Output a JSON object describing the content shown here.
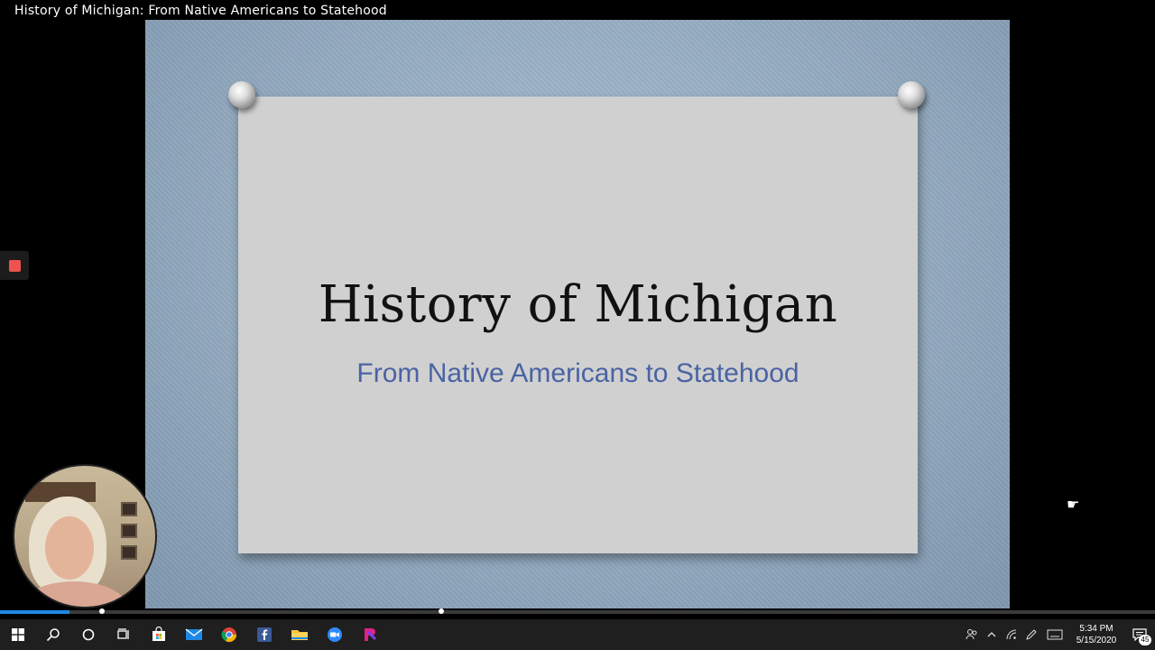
{
  "video": {
    "title": "History of Michigan: From Native Americans to Statehood",
    "progress_fraction": 0.06
  },
  "slide": {
    "title": "History of Michigan",
    "subtitle": "From Native Americans to Statehood",
    "subtitle_color": "#4a63a4",
    "card_color": "#d0d0d0"
  },
  "recorder": {
    "stop_icon": "stop-square-icon",
    "stop_color": "#ef5350"
  },
  "taskbar": {
    "apps": [
      {
        "name": "windows-start",
        "icon": "windows-logo-icon"
      },
      {
        "name": "search",
        "icon": "search-icon"
      },
      {
        "name": "cortana",
        "icon": "circle-icon"
      },
      {
        "name": "task-view",
        "icon": "task-view-icon"
      },
      {
        "name": "microsoft-store",
        "icon": "store-bag-icon"
      },
      {
        "name": "mail",
        "icon": "mail-icon"
      },
      {
        "name": "chrome",
        "icon": "chrome-icon"
      },
      {
        "name": "facebook",
        "icon": "facebook-icon"
      },
      {
        "name": "file-explorer",
        "icon": "folder-icon"
      },
      {
        "name": "zoom",
        "icon": "zoom-camera-icon"
      },
      {
        "name": "app-pink",
        "icon": "ribbon-app-icon"
      }
    ],
    "clock": {
      "time": "5:34 PM",
      "date": "5/15/2020"
    },
    "notification_count": "45"
  }
}
